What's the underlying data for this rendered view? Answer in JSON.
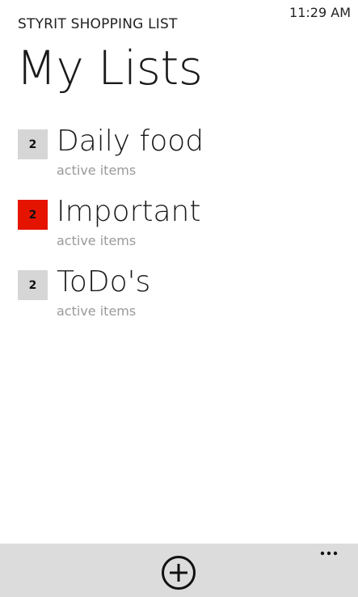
{
  "status": {
    "time": "11:29 AM"
  },
  "header": {
    "app_title": "STYRIT SHOPPING LIST",
    "page_title": "My Lists"
  },
  "lists": [
    {
      "name": "Daily food",
      "count": "2",
      "subtitle": "active items",
      "badge_color": "#d6d6d6"
    },
    {
      "name": "Important",
      "count": "2",
      "subtitle": "active items",
      "badge_color": "#e51400"
    },
    {
      "name": "ToDo's",
      "count": "2",
      "subtitle": "active items",
      "badge_color": "#d6d6d6"
    }
  ],
  "app_bar": {
    "add_icon": "add-circle-icon",
    "more_icon": "more-ellipsis-icon",
    "background": "#dcdcdc"
  }
}
